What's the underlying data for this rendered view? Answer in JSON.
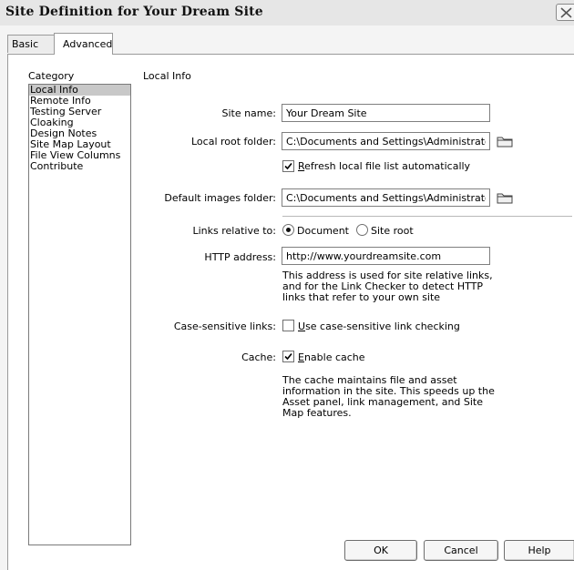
{
  "window": {
    "title": "Site Definition for Your Dream Site"
  },
  "tabs": [
    {
      "label": "Basic"
    },
    {
      "label": "Advanced"
    }
  ],
  "category": {
    "label": "Category",
    "items": [
      "Local Info",
      "Remote Info",
      "Testing Server",
      "Cloaking",
      "Design Notes",
      "Site Map Layout",
      "File View Columns",
      "Contribute"
    ],
    "selected": "Local Info"
  },
  "local_info": {
    "section_title": "Local Info",
    "site_name": {
      "label": "Site name:",
      "value": "Your Dream Site"
    },
    "local_root": {
      "label": "Local root folder:",
      "value": "C:\\Documents and Settings\\Administrator"
    },
    "refresh": {
      "label_first": "R",
      "label_rest": "efresh local file list automatically",
      "checked": true
    },
    "default_images": {
      "label": "Default images folder:",
      "value": "C:\\Documents and Settings\\Administrator"
    },
    "links_relative": {
      "label": "Links relative to:",
      "document_label": "Document",
      "site_root_label": "Site root",
      "selected": "Document"
    },
    "http_address": {
      "label": "HTTP address:",
      "value": "http://www.yourdreamsite.com",
      "note": "This address is used for site relative links,\nand for the Link Checker to detect HTTP\nlinks that refer to your own site"
    },
    "case_sensitive": {
      "label": "Case-sensitive links:",
      "option_first": "U",
      "option_rest": "se case-sensitive link checking",
      "checked": false
    },
    "cache": {
      "label": "Cache:",
      "option_first": "E",
      "option_rest": "nable cache",
      "checked": true,
      "note": "The cache maintains file and asset\ninformation in the site.  This speeds up the\nAsset panel, link management, and Site\nMap features."
    }
  },
  "buttons": {
    "ok": "OK",
    "cancel": "Cancel",
    "help": "Help"
  },
  "icons": {
    "close": "close-icon",
    "folder": "folder-icon",
    "check": "checkmark-icon"
  }
}
